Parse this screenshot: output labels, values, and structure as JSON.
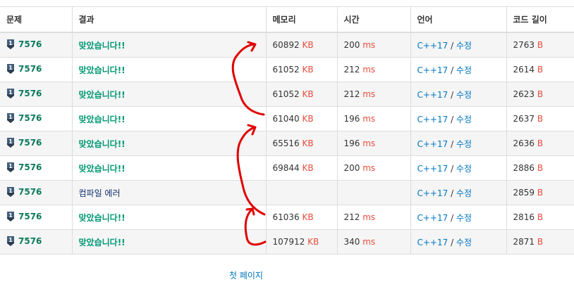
{
  "headers": {
    "problem": "문제",
    "result": "결과",
    "memory": "메모리",
    "time": "시간",
    "language": "언어",
    "code_length": "코드 길이"
  },
  "colors": {
    "accepted": "#009874",
    "unit": "#e74c3c",
    "link": "#0076c0",
    "annotation": "#e00000"
  },
  "rows": [
    {
      "problem": "7576",
      "result": "맞았습니다!!",
      "memory": "60892",
      "memory_unit": "KB",
      "time": "200",
      "time_unit": "ms",
      "language": "C++17",
      "sep": "/",
      "edit": "수정",
      "code_length": "2763",
      "length_unit": "B"
    },
    {
      "problem": "7576",
      "result": "맞았습니다!!",
      "memory": "61052",
      "memory_unit": "KB",
      "time": "212",
      "time_unit": "ms",
      "language": "C++17",
      "sep": "/",
      "edit": "수정",
      "code_length": "2614",
      "length_unit": "B"
    },
    {
      "problem": "7576",
      "result": "맞았습니다!!",
      "memory": "61052",
      "memory_unit": "KB",
      "time": "212",
      "time_unit": "ms",
      "language": "C++17",
      "sep": "/",
      "edit": "수정",
      "code_length": "2623",
      "length_unit": "B"
    },
    {
      "problem": "7576",
      "result": "맞았습니다!!",
      "memory": "61040",
      "memory_unit": "KB",
      "time": "196",
      "time_unit": "ms",
      "language": "C++17",
      "sep": "/",
      "edit": "수정",
      "code_length": "2637",
      "length_unit": "B"
    },
    {
      "problem": "7576",
      "result": "맞았습니다!!",
      "memory": "65516",
      "memory_unit": "KB",
      "time": "196",
      "time_unit": "ms",
      "language": "C++17",
      "sep": "/",
      "edit": "수정",
      "code_length": "2636",
      "length_unit": "B"
    },
    {
      "problem": "7576",
      "result": "맞았습니다!!",
      "memory": "69844",
      "memory_unit": "KB",
      "time": "200",
      "time_unit": "ms",
      "language": "C++17",
      "sep": "/",
      "edit": "수정",
      "code_length": "2886",
      "length_unit": "B"
    },
    {
      "problem": "7576",
      "result": "컴파일 에러",
      "memory": "",
      "memory_unit": "",
      "time": "",
      "time_unit": "",
      "language": "C++17",
      "sep": "/",
      "edit": "수정",
      "code_length": "2859",
      "length_unit": "B"
    },
    {
      "problem": "7576",
      "result": "맞았습니다!!",
      "memory": "61036",
      "memory_unit": "KB",
      "time": "212",
      "time_unit": "ms",
      "language": "C++17",
      "sep": "/",
      "edit": "수정",
      "code_length": "2816",
      "length_unit": "B"
    },
    {
      "problem": "7576",
      "result": "맞았습니다!!",
      "memory": "107912",
      "memory_unit": "KB",
      "time": "340",
      "time_unit": "ms",
      "language": "C++17",
      "sep": "/",
      "edit": "수정",
      "code_length": "2871",
      "length_unit": "B"
    }
  ],
  "pagination": {
    "first_page": "첫 페이지"
  }
}
